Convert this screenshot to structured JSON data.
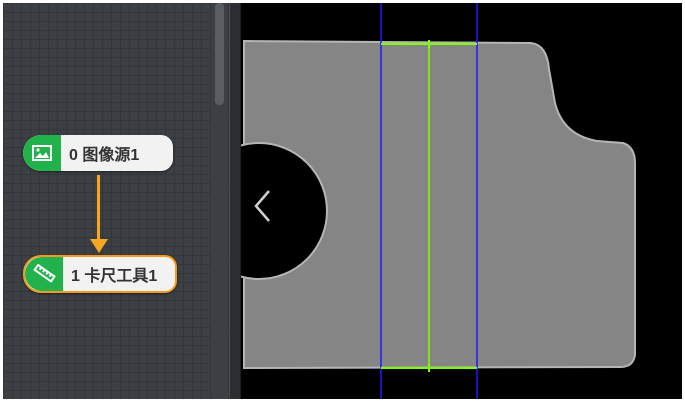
{
  "flow": {
    "nodes": [
      {
        "index_label": "0 图像源1",
        "icon": "image-icon"
      },
      {
        "index_label": "1 卡尺工具1",
        "icon": "caliper-icon"
      }
    ],
    "connector_color": "#f5a623",
    "selected_border_color": "#f29b1e",
    "node_icon_bg": "#22b24c"
  },
  "viewer": {
    "nav_icon": "chevron-left-icon",
    "roi_color": "#0000ff",
    "edge_color": "#7fff00"
  }
}
